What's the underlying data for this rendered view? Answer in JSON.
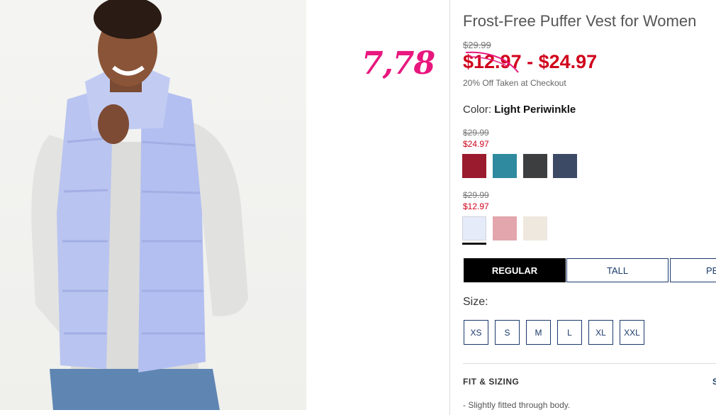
{
  "product": {
    "title": "Frost-Free Puffer Vest for Women",
    "original_price": "$29.99",
    "sale_price": "$12.97 - $24.97",
    "checkout_note": "20% Off Taken at Checkout"
  },
  "annotation": "7,78",
  "color": {
    "label": "Color:",
    "selected": "Light Periwinkle",
    "groups": [
      {
        "original_price": "$29.99",
        "sale_price": "$24.97",
        "swatches": [
          {
            "name": "burgundy",
            "color": "#9b1b2e"
          },
          {
            "name": "teal",
            "color": "#2f8aa0"
          },
          {
            "name": "charcoal",
            "color": "#3c3e40"
          },
          {
            "name": "navy",
            "color": "#3d4a66"
          }
        ]
      },
      {
        "original_price": "$29.99",
        "sale_price": "$12.97",
        "swatches": [
          {
            "name": "light-periwinkle",
            "color": "#e6ebfa"
          },
          {
            "name": "pink",
            "color": "#e3a6ad"
          },
          {
            "name": "cream",
            "color": "#efe8df"
          }
        ]
      }
    ]
  },
  "fit_options": [
    "REGULAR",
    "TALL",
    "PE"
  ],
  "size": {
    "label": "Size:",
    "options": [
      "XS",
      "S",
      "M",
      "L",
      "XL",
      "XXL"
    ]
  },
  "fit_sizing": {
    "heading": "FIT & SIZING",
    "link": "S",
    "bullet": "- Slightly fitted through body."
  }
}
